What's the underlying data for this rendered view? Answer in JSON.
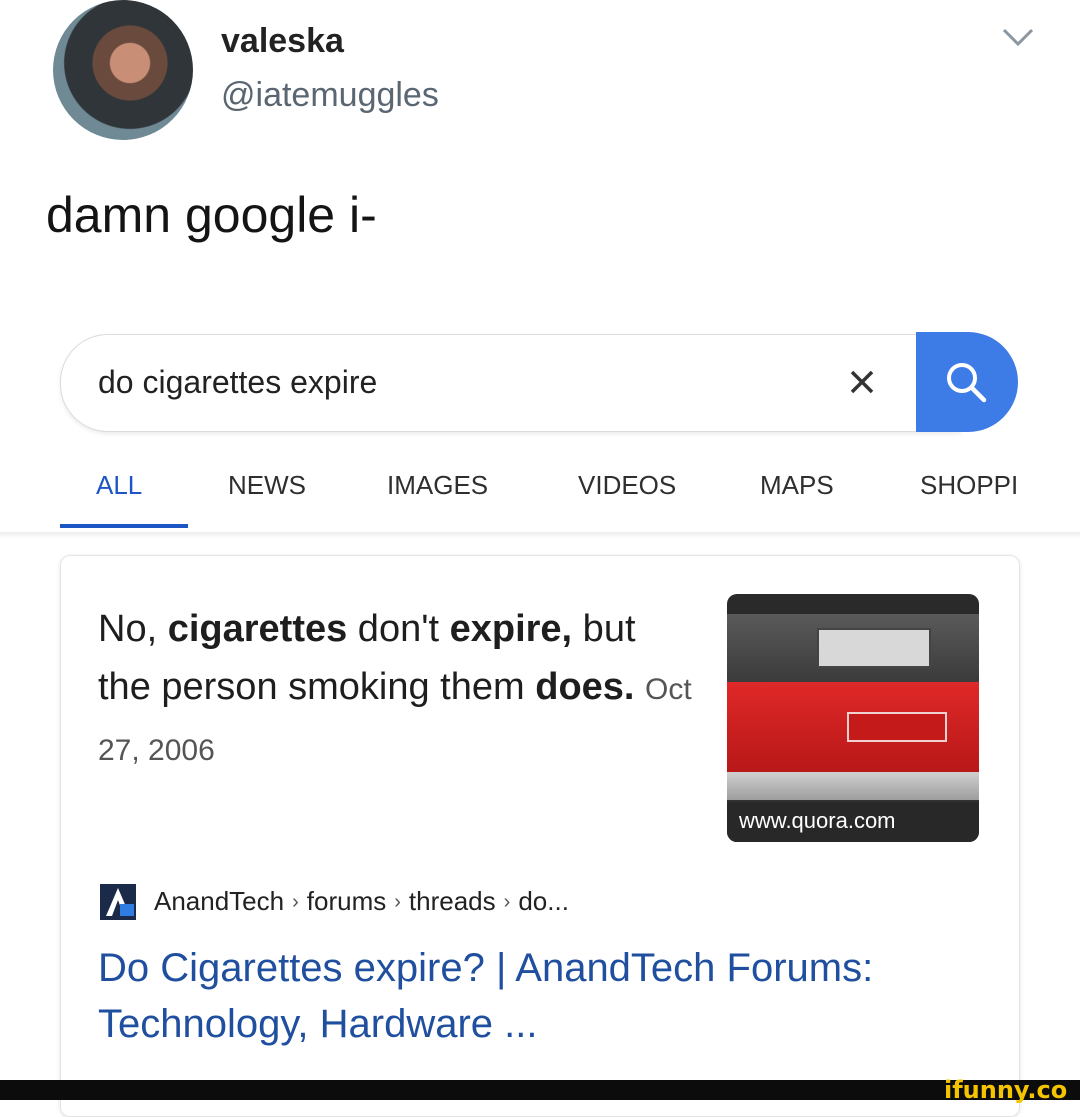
{
  "post": {
    "user_name": "valeska",
    "user_handle": "@iatemuggles",
    "text": "damn google i-"
  },
  "search": {
    "query": "do cigarettes expire"
  },
  "tabs": [
    "ALL",
    "NEWS",
    "IMAGES",
    "VIDEOS",
    "MAPS",
    "SHOPPI"
  ],
  "answer": {
    "part1": "No, ",
    "bold1": "cigarettes",
    "part2": " don't ",
    "bold2": "expire,",
    "part3": " but the person smoking them ",
    "bold3": "does.",
    "date": "Oct 27, 2006"
  },
  "thumbnail": {
    "caption": "www.quora.com"
  },
  "result": {
    "source": "AnandTech",
    "path": [
      "forums",
      "threads",
      "do..."
    ],
    "title": "Do Cigarettes expire? | AnandTech Forums: Technology, Hardware ..."
  },
  "footer": {
    "watermark": "ifunny.co"
  },
  "colors": {
    "accent_blue": "#3d7be6",
    "link_blue": "#1f4f9e",
    "tab_active": "#1d56c4",
    "watermark_yellow": "#f5c400"
  },
  "icons": [
    "chevron-down-icon",
    "close-icon",
    "search-icon",
    "anandtech-logo-icon"
  ]
}
